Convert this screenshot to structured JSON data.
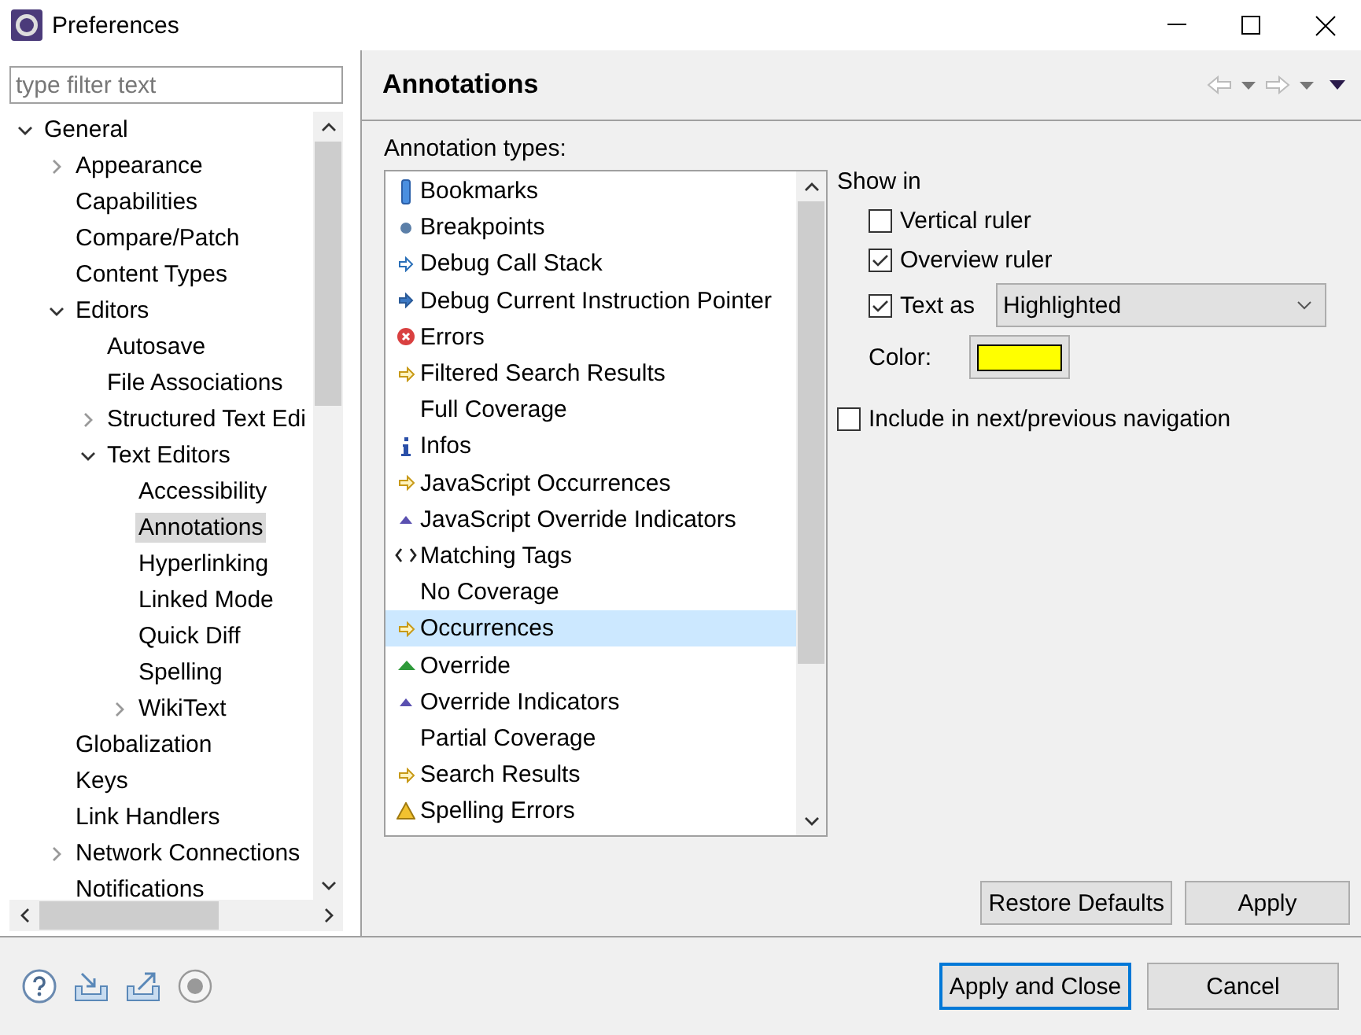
{
  "window": {
    "title": "Preferences"
  },
  "filter": {
    "placeholder": "type filter text"
  },
  "tree": [
    {
      "label": "General",
      "expanded": true,
      "selected": false,
      "children": [
        {
          "label": "Appearance",
          "expanded": false,
          "selected": false
        },
        {
          "label": "Capabilities",
          "selected": false
        },
        {
          "label": "Compare/Patch",
          "selected": false
        },
        {
          "label": "Content Types",
          "selected": false
        },
        {
          "label": "Editors",
          "expanded": true,
          "selected": false,
          "children": [
            {
              "label": "Autosave",
              "selected": false
            },
            {
              "label": "File Associations",
              "selected": false
            },
            {
              "label": "Structured Text Edi",
              "expanded": false,
              "selected": false
            },
            {
              "label": "Text Editors",
              "expanded": true,
              "selected": false,
              "children": [
                {
                  "label": "Accessibility",
                  "selected": false
                },
                {
                  "label": "Annotations",
                  "selected": true
                },
                {
                  "label": "Hyperlinking",
                  "selected": false
                },
                {
                  "label": "Linked Mode",
                  "selected": false
                },
                {
                  "label": "Quick Diff",
                  "selected": false
                },
                {
                  "label": "Spelling",
                  "selected": false
                },
                {
                  "label": "WikiText",
                  "expanded": false,
                  "selected": false
                }
              ]
            }
          ]
        },
        {
          "label": "Globalization",
          "selected": false
        },
        {
          "label": "Keys",
          "selected": false
        },
        {
          "label": "Link Handlers",
          "selected": false
        },
        {
          "label": "Network Connections",
          "expanded": false,
          "selected": false
        },
        {
          "label": "Notifications",
          "selected": false
        }
      ]
    }
  ],
  "page": {
    "title": "Annotations",
    "list_label": "Annotation types:"
  },
  "annotation_types": [
    {
      "label": "Bookmarks",
      "kind": "bookmark",
      "selected": false
    },
    {
      "label": "Breakpoints",
      "kind": "dot",
      "selected": false
    },
    {
      "label": "Debug Call Stack",
      "kind": "arrow-outline",
      "selected": false
    },
    {
      "label": "Debug Current Instruction Pointer",
      "kind": "arrow-solid",
      "selected": false
    },
    {
      "label": "Errors",
      "kind": "error",
      "selected": false
    },
    {
      "label": "Filtered Search Results",
      "kind": "arrow-gold",
      "selected": false
    },
    {
      "label": "Full Coverage",
      "kind": "none",
      "selected": false
    },
    {
      "label": "Infos",
      "kind": "info",
      "selected": false
    },
    {
      "label": "JavaScript Occurrences",
      "kind": "arrow-gold",
      "selected": false
    },
    {
      "label": "JavaScript Override Indicators",
      "kind": "triangle-small",
      "selected": false
    },
    {
      "label": "Matching Tags",
      "kind": "tags",
      "selected": false
    },
    {
      "label": "No Coverage",
      "kind": "none",
      "selected": false
    },
    {
      "label": "Occurrences",
      "kind": "arrow-gold",
      "selected": true
    },
    {
      "label": "Override",
      "kind": "triangle-green",
      "selected": false
    },
    {
      "label": "Override Indicators",
      "kind": "triangle-small",
      "selected": false
    },
    {
      "label": "Partial Coverage",
      "kind": "none",
      "selected": false
    },
    {
      "label": "Search Results",
      "kind": "arrow-gold",
      "selected": false
    },
    {
      "label": "Spelling Errors",
      "kind": "warning",
      "selected": false
    }
  ],
  "options": {
    "show_in_label": "Show in",
    "vertical_ruler": {
      "label": "Vertical ruler",
      "checked": false
    },
    "overview_ruler": {
      "label": "Overview ruler",
      "checked": true
    },
    "text_as": {
      "label": "Text as",
      "checked": true,
      "value": "Highlighted"
    },
    "color": {
      "label": "Color:",
      "color": "#ffff00"
    },
    "include_navigation": {
      "label": "Include in next/previous navigation",
      "checked": false
    }
  },
  "page_buttons": [
    {
      "label": "Restore Defaults",
      "default": false
    },
    {
      "label": "Apply",
      "default": false
    }
  ],
  "dialog_buttons": [
    {
      "label": "Apply and Close",
      "default": true
    },
    {
      "label": "Cancel",
      "default": false
    }
  ]
}
